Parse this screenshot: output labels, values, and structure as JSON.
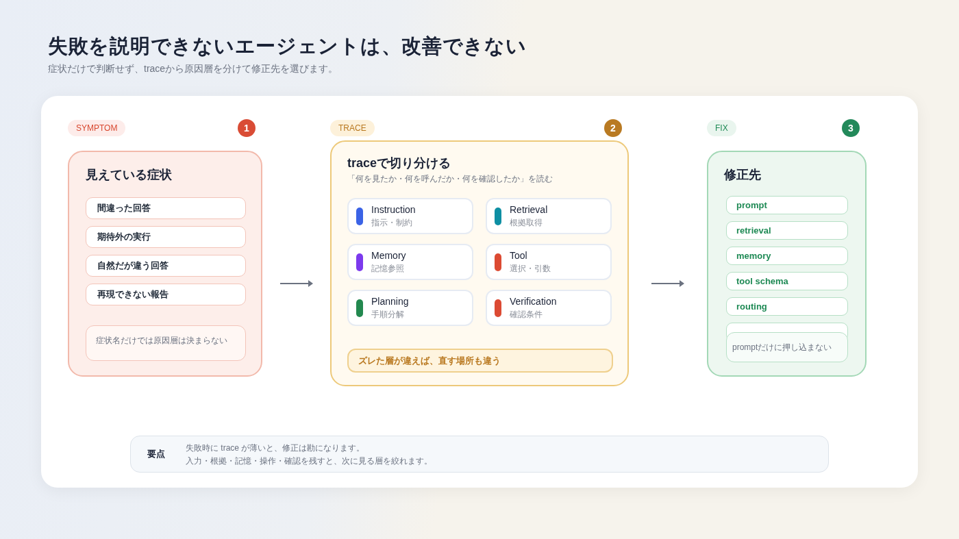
{
  "title": "失敗を説明できないエージェントは、改善できない",
  "subtitle": "症状だけで判断せず、traceから原因層を分けて修正先を選びます。",
  "steps": [
    {
      "kind": "symptom",
      "tag": "SYMPTOM",
      "number": "1",
      "heading": "見えている症状",
      "items": [
        "間違った回答",
        "期待外の実行",
        "自然だが違う回答",
        "再現できない報告"
      ],
      "note": "症状名だけでは原因層は決まらない"
    },
    {
      "kind": "trace",
      "tag": "TRACE",
      "number": "2",
      "heading": "traceで切り分ける",
      "caption": "「何を見たか・何を呼んだか・何を確認したか」を読む",
      "layers": [
        {
          "name": "Instruction",
          "desc": "指示・制約",
          "color": "#3b63e6"
        },
        {
          "name": "Retrieval",
          "desc": "根拠取得",
          "color": "#0e8fa3"
        },
        {
          "name": "Memory",
          "desc": "記憶参照",
          "color": "#7c3aed"
        },
        {
          "name": "Tool",
          "desc": "選択・引数",
          "color": "#dc4a32"
        },
        {
          "name": "Planning",
          "desc": "手順分解",
          "color": "#23884f"
        },
        {
          "name": "Verification",
          "desc": "確認条件",
          "color": "#dc4a33"
        }
      ],
      "callout": "ズレた層が違えば、直す場所も違う"
    },
    {
      "kind": "fix",
      "tag": "FIX",
      "number": "3",
      "heading": "修正先",
      "items": [
        "prompt",
        "retrieval",
        "memory",
        "tool schema",
        "routing"
      ],
      "note": "promptだけに押し込まない"
    }
  ],
  "summary": {
    "label": "要点",
    "lines": [
      "失敗時に trace が薄いと、修正は勘になります。",
      "入力・根拠・記憶・操作・確認を残すと、次に見る層を絞れます。"
    ]
  }
}
